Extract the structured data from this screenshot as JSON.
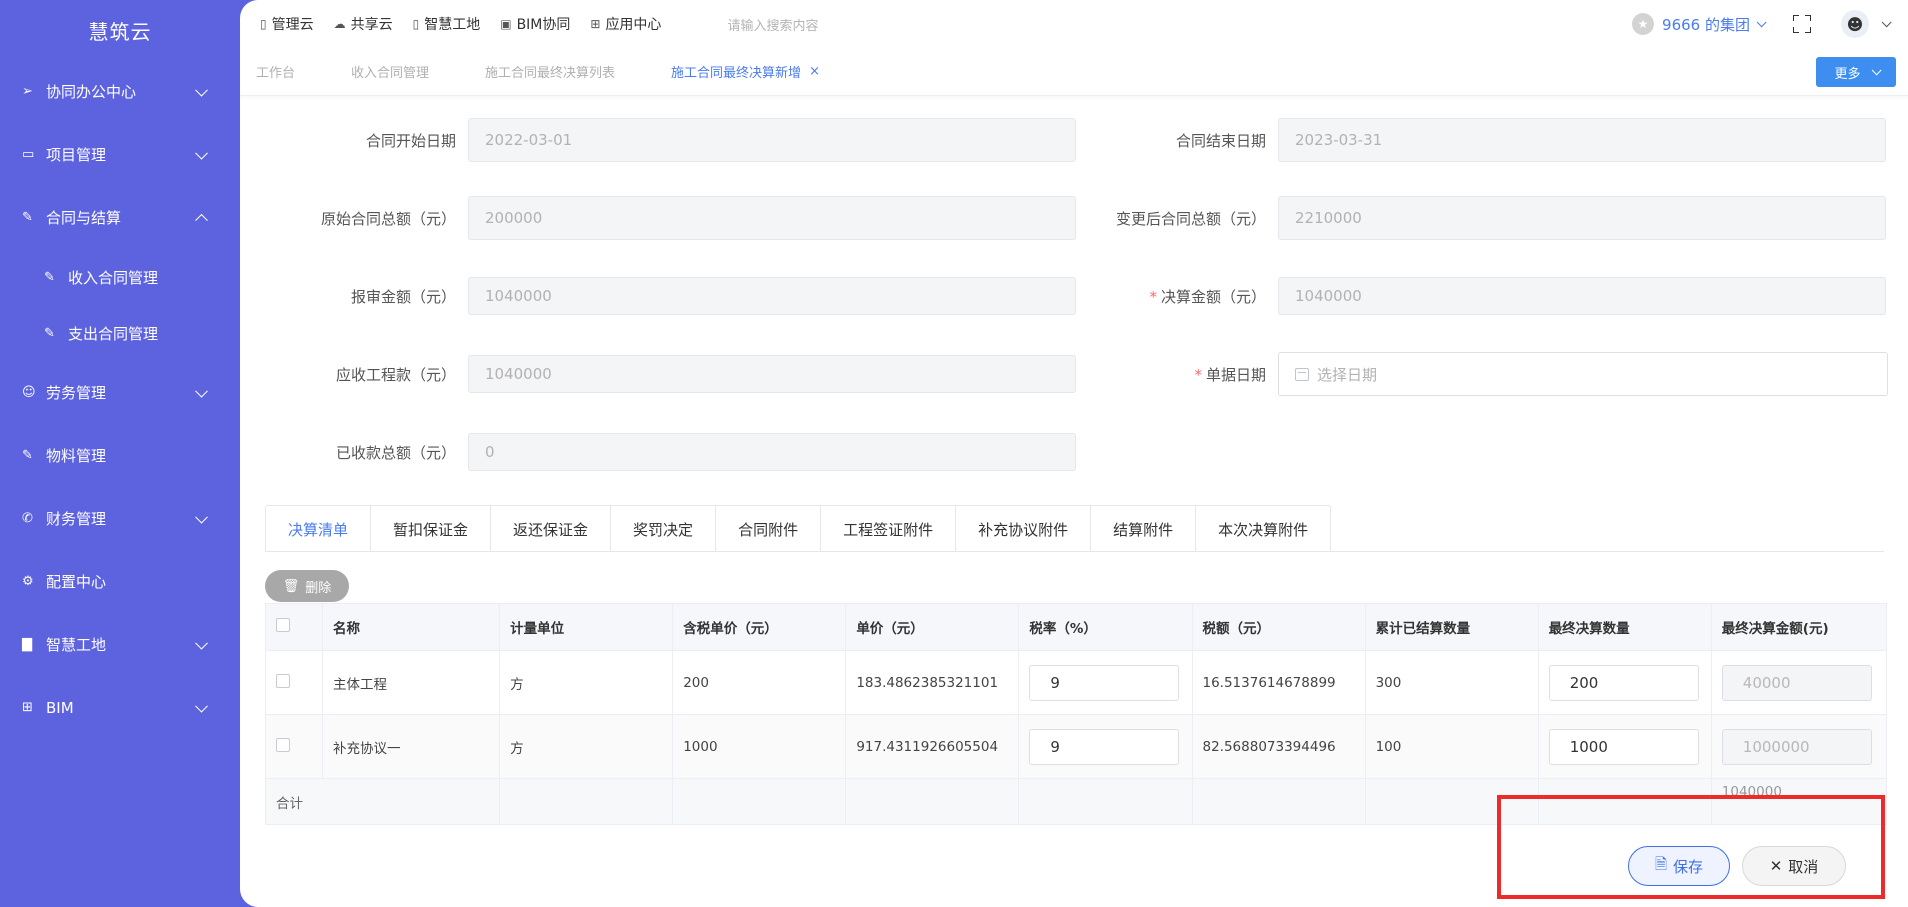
{
  "app": {
    "title": "慧筑云"
  },
  "sidebar": {
    "items": [
      {
        "label": "协同办公中心",
        "icon": "send-icon",
        "expandable": true,
        "expanded": false
      },
      {
        "label": "项目管理",
        "icon": "book-icon",
        "expandable": true,
        "expanded": false
      },
      {
        "label": "合同与结算",
        "icon": "edit-icon",
        "expandable": true,
        "expanded": true
      },
      {
        "label": "收入合同管理",
        "icon": "edit-icon",
        "sub": true
      },
      {
        "label": "支出合同管理",
        "icon": "edit-icon",
        "sub": true
      },
      {
        "label": "劳务管理",
        "icon": "users-icon",
        "expandable": true,
        "expanded": false
      },
      {
        "label": "物料管理",
        "icon": "edit-icon",
        "expandable": false
      },
      {
        "label": "财务管理",
        "icon": "phone-icon",
        "expandable": true,
        "expanded": false
      },
      {
        "label": "配置中心",
        "icon": "gear-icon",
        "expandable": false
      },
      {
        "label": "智慧工地",
        "icon": "bar-chart-icon",
        "expandable": true,
        "expanded": false
      },
      {
        "label": "BIM",
        "icon": "grid-icon",
        "expandable": true,
        "expanded": false
      }
    ]
  },
  "topbar": {
    "links": [
      {
        "label": "管理云",
        "icon": "tablet-icon"
      },
      {
        "label": "共享云",
        "icon": "cloud-icon"
      },
      {
        "label": "智慧工地",
        "icon": "document-icon"
      },
      {
        "label": "BIM协同",
        "icon": "box-icon"
      },
      {
        "label": "应用中心",
        "icon": "apps-icon"
      }
    ],
    "search_placeholder": "请输入搜索内容",
    "group_name": "9666 的集团"
  },
  "tabs": {
    "items": [
      {
        "label": "工作台",
        "active": false
      },
      {
        "label": "收入合同管理",
        "active": false
      },
      {
        "label": "施工合同最终决算列表",
        "active": false
      },
      {
        "label": "施工合同最终决算新增",
        "active": true,
        "closable": true
      }
    ],
    "close_glyph": "×",
    "more_label": "更多"
  },
  "form": {
    "start_date": {
      "label": "合同开始日期",
      "value": "2022-03-01"
    },
    "end_date": {
      "label": "合同结束日期",
      "value": "2023-03-31"
    },
    "original_total": {
      "label": "原始合同总额（元）",
      "value": "200000"
    },
    "changed_total": {
      "label": "变更后合同总额（元）",
      "value": "2210000"
    },
    "submitted_amount": {
      "label": "报审金额（元）",
      "value": "1040000"
    },
    "final_amount": {
      "label": "决算金额（元）",
      "value": "1040000",
      "required": true
    },
    "receivable": {
      "label": "应收工程款（元）",
      "value": "1040000"
    },
    "bill_date": {
      "label": "单据日期",
      "placeholder": "选择日期",
      "required": true
    },
    "received_total": {
      "label": "已收款总额（元）",
      "value": "0"
    },
    "required_mark": "*"
  },
  "detail_tabs": [
    "决算清单",
    "暂扣保证金",
    "返还保证金",
    "奖罚决定",
    "合同附件",
    "工程签证附件",
    "补充协议附件",
    "结算附件",
    "本次决算附件"
  ],
  "delete_label": "删除",
  "table": {
    "headers": [
      "名称",
      "计量单位",
      "含税单价（元）",
      "单价（元）",
      "税率（%）",
      "税额（元）",
      "累计已结算数量",
      "最终决算数量",
      "最终决算金额(元)"
    ],
    "rows": [
      {
        "name": "主体工程",
        "unit": "方",
        "tax_price": "200",
        "price": "183.4862385321101",
        "tax_rate": "9",
        "tax": "16.5137614678899",
        "settled_qty": "300",
        "final_qty": "200",
        "final_amount": "40000"
      },
      {
        "name": "补充协议一",
        "unit": "方",
        "tax_price": "1000",
        "price": "917.4311926605504",
        "tax_rate": "9",
        "tax": "82.5688073394496",
        "settled_qty": "100",
        "final_qty": "1000",
        "final_amount": "1000000"
      }
    ],
    "total_label": "合计",
    "total_amount": "1040000"
  },
  "actions": {
    "save_label": "保存",
    "cancel_label": "取消"
  },
  "colors": {
    "sidebar": "#5d63df",
    "accent": "#4a7cf0",
    "highlight": "#ec2b2b",
    "required": "#f56c6c"
  }
}
